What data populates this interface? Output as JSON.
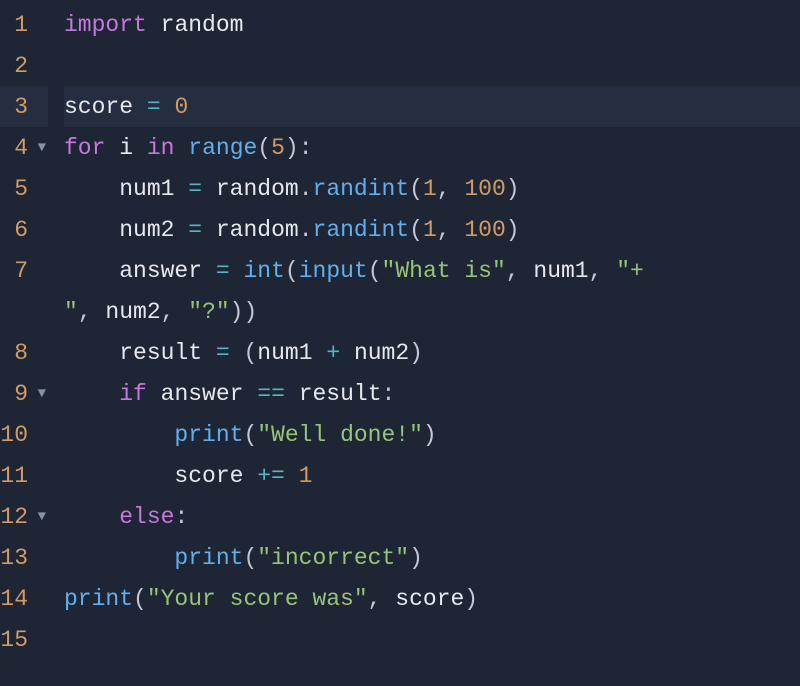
{
  "editor": {
    "gutter": [
      {
        "n": "1",
        "fold": ""
      },
      {
        "n": "2",
        "fold": ""
      },
      {
        "n": "3",
        "fold": ""
      },
      {
        "n": "4",
        "fold": "▼"
      },
      {
        "n": "5",
        "fold": ""
      },
      {
        "n": "6",
        "fold": ""
      },
      {
        "n": "7",
        "fold": ""
      },
      {
        "n": "",
        "fold": ""
      },
      {
        "n": "8",
        "fold": ""
      },
      {
        "n": "9",
        "fold": "▼"
      },
      {
        "n": "10",
        "fold": ""
      },
      {
        "n": "11",
        "fold": ""
      },
      {
        "n": "12",
        "fold": "▼"
      },
      {
        "n": "13",
        "fold": ""
      },
      {
        "n": "14",
        "fold": ""
      },
      {
        "n": "15",
        "fold": ""
      }
    ],
    "code": {
      "l1": {
        "kw": "import",
        "sp": " ",
        "mod": "random"
      },
      "l2": {
        "blank": ""
      },
      "l3": {
        "var": "score",
        "sp1": " ",
        "op": "=",
        "sp2": " ",
        "num": "0"
      },
      "l4": {
        "kw1": "for",
        "sp1": " ",
        "var": "i",
        "sp2": " ",
        "kw2": "in",
        "sp3": " ",
        "fn": "range",
        "p1": "(",
        "num": "5",
        "p2": "):"
      },
      "l5": {
        "ind": "    ",
        "var": "num1",
        "sp1": " ",
        "op": "=",
        "sp2": " ",
        "mod": "random",
        "dot": ".",
        "fn": "randint",
        "p1": "(",
        "n1": "1",
        "c": ", ",
        "n2": "100",
        "p2": ")"
      },
      "l6": {
        "ind": "    ",
        "var": "num2",
        "sp1": " ",
        "op": "=",
        "sp2": " ",
        "mod": "random",
        "dot": ".",
        "fn": "randint",
        "p1": "(",
        "n1": "1",
        "c": ", ",
        "n2": "100",
        "p2": ")"
      },
      "l7": {
        "ind": "    ",
        "var": "answer",
        "sp1": " ",
        "op": "=",
        "sp2": " ",
        "fn1": "int",
        "p1": "(",
        "fn2": "input",
        "p2": "(",
        "s1": "\"What is\"",
        "c1": ", ",
        "v1": "num1",
        "c2": ", ",
        "s2": "\"+"
      },
      "l7b": {
        "s3": "\"",
        "c3": ", ",
        "v2": "num2",
        "c4": ", ",
        "s4": "\"?\"",
        "p3": "))"
      },
      "l8": {
        "ind": "    ",
        "var": "result",
        "sp1": " ",
        "op": "=",
        "sp2": " ",
        "p1": "(",
        "v1": "num1",
        "sp3": " ",
        "plus": "+",
        "sp4": " ",
        "v2": "num2",
        "p2": ")"
      },
      "l9": {
        "ind": "    ",
        "kw": "if",
        "sp1": " ",
        "v1": "answer",
        "sp2": " ",
        "op": "==",
        "sp3": " ",
        "v2": "result",
        "colon": ":"
      },
      "l10": {
        "ind": "        ",
        "fn": "print",
        "p1": "(",
        "s": "\"Well done!\"",
        "p2": ")"
      },
      "l11": {
        "ind": "        ",
        "var": "score",
        "sp1": " ",
        "op": "+=",
        "sp2": " ",
        "num": "1"
      },
      "l12": {
        "ind": "    ",
        "kw": "else",
        "colon": ":"
      },
      "l13": {
        "ind": "        ",
        "fn": "print",
        "p1": "(",
        "s": "\"incorrect\"",
        "p2": ")"
      },
      "l14": {
        "fn": "print",
        "p1": "(",
        "s": "\"Your score was\"",
        "c": ", ",
        "v": "score",
        "p2": ")"
      },
      "l15": {
        "blank": ""
      }
    },
    "highlighted_line": 3
  }
}
